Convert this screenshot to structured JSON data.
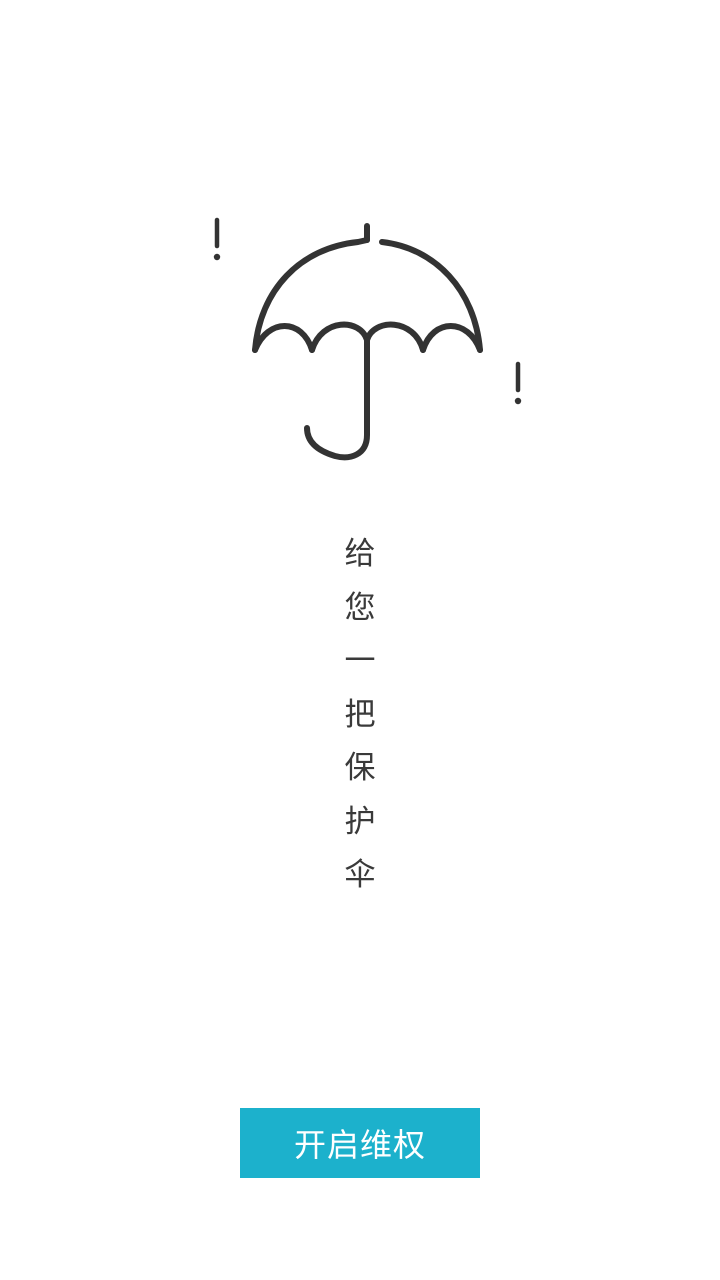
{
  "hero": {
    "icon": "umbrella-icon",
    "decorations": [
      "exclamation-icon",
      "exclamation-icon"
    ]
  },
  "slogan": {
    "chars": [
      "给",
      "您",
      "一",
      "把",
      "保",
      "护",
      "伞"
    ]
  },
  "cta": {
    "label": "开启维权",
    "color": "#1cb1cc"
  },
  "colors": {
    "icon_stroke": "#333333",
    "text": "#3a3a3a",
    "background": "#ffffff"
  }
}
